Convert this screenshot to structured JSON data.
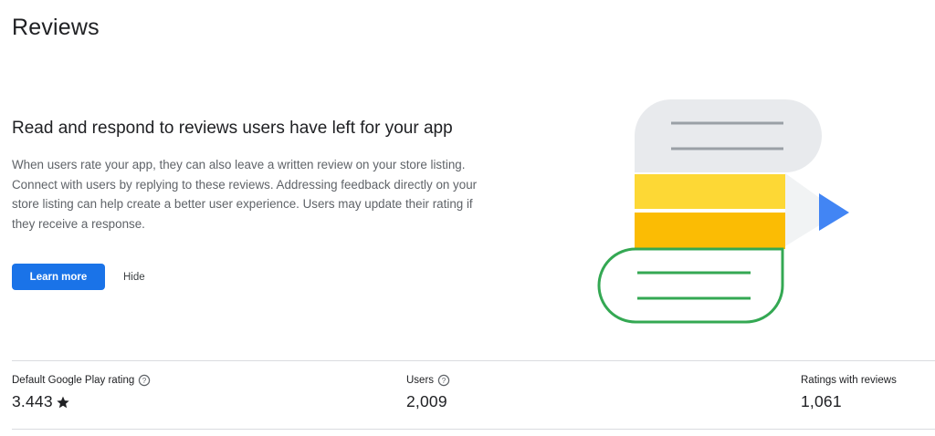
{
  "page": {
    "title": "Reviews"
  },
  "intro": {
    "heading": "Read and respond to reviews users have left for your app",
    "body": "When users rate your app, they can also leave a written review on your store listing. Connect with users by replying to these reviews. Addressing feedback directly on your store listing can help create a better user experience. Users may update their rating if they receive a response.",
    "learn_more_label": "Learn more",
    "hide_label": "Hide"
  },
  "stats": [
    {
      "label": "Default Google Play rating",
      "value": "3.443",
      "has_help": true,
      "icon": "star-icon"
    },
    {
      "label": "Users",
      "value": "2,009",
      "has_help": true
    },
    {
      "label": "Ratings with reviews",
      "value": "1,061",
      "has_help": false
    }
  ],
  "colors": {
    "primary": "#1a73e8",
    "illustration_grey": "#e8eaed",
    "illustration_yellow": "#fdd835",
    "illustration_amber": "#fbbc04",
    "illustration_green": "#34a853",
    "illustration_blue": "#4285f4"
  }
}
